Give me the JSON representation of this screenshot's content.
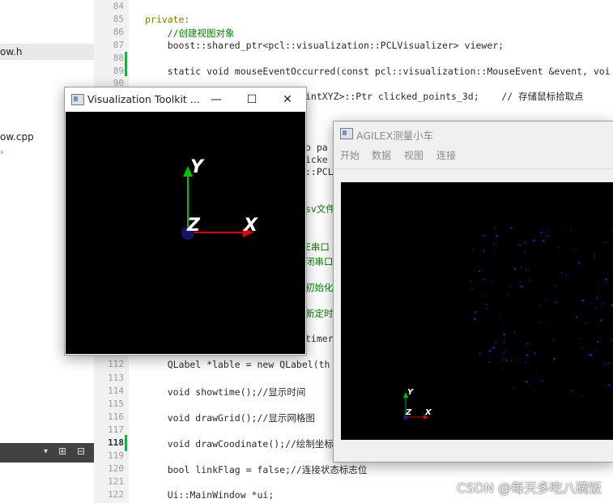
{
  "left_panel": {
    "items": [
      {
        "label": "ow.h"
      },
      {
        "label": "ow.cpp"
      }
    ]
  },
  "editor": {
    "line_numbers": [
      "84",
      "85",
      "86",
      "87",
      "88",
      "89",
      "90",
      "",
      "",
      "",
      "",
      "",
      "",
      "",
      "",
      "",
      "",
      "",
      "",
      "",
      "",
      "",
      "112",
      "113",
      "114",
      "115",
      "116",
      "117",
      "118",
      "119",
      "120",
      "121",
      "122"
    ],
    "lines": {
      "l85": "private:",
      "l86": "    //创建视图对象",
      "l87": "    boost::shared_ptr<pcl::visualization::PCLVisualizer> viewer;",
      "l89": "    static void mouseEventOccurred(const pcl::visualization::MouseEvent &event, voi",
      "l91": "intXYZ>::Ptr clicked_points_3d;    // 存储鼠标拾取点",
      "l_p1": "o pa",
      "l_p2": "icke",
      "l_p3": "::PCL",
      "l_p4": "sv文件",
      "l_p5": "E串口",
      "l_p6": "闭串口",
      "l_p7": "初始化",
      "l_p8": "新定时",
      "l_p9": "timer",
      "l112": "    QLabel *lable = new QLabel(th",
      "l114": "    void showtime();//显示时间",
      "l116": "    void drawGrid();//显示网格图",
      "l118": "    void drawCoodinate();//绘制坐标",
      "l120": "    bool linkFlag = false;//连接状态标志位",
      "l122": "    Ui::MainWindow *ui;"
    }
  },
  "vtk_window": {
    "title": "Visualization Toolkit ...",
    "axis_labels": {
      "x": "X",
      "y": "Y",
      "z": "Z"
    },
    "colors": {
      "x": "#e00000",
      "y": "#00c000",
      "z": "#1a1a8a"
    }
  },
  "agilex_window": {
    "title": "AGILEX测量小车",
    "menu": [
      "开始",
      "数据",
      "视图",
      "连接"
    ],
    "axis_labels": {
      "x": "X",
      "y": "Y",
      "z": "Z"
    }
  },
  "watermark": "CSDN @每天多吃八碗饭",
  "icons": {
    "minimize": "minimize-icon",
    "maximize": "maximize-icon",
    "close": "close-icon"
  }
}
